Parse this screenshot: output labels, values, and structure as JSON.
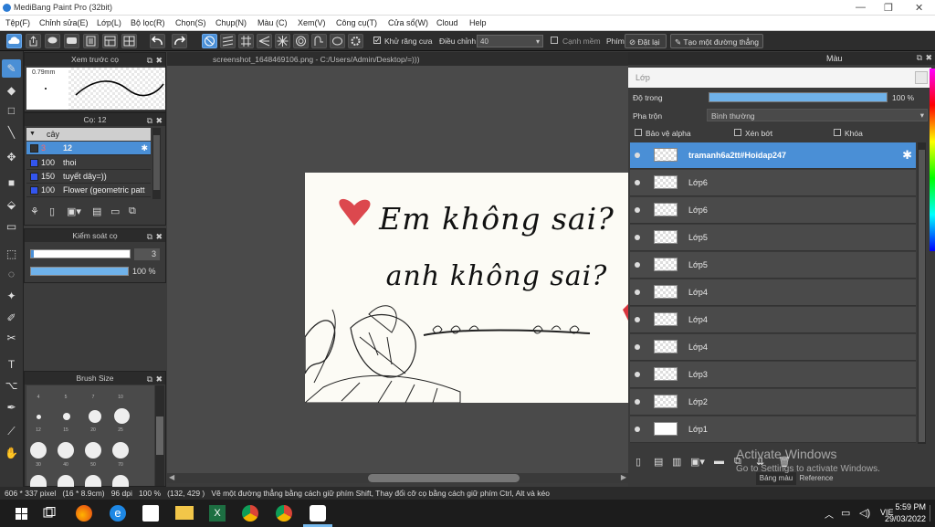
{
  "window": {
    "title": "MediBang Paint Pro (32bit)",
    "min": "—",
    "max": "❐",
    "close": "✕"
  },
  "menu": [
    "Tệp(F)",
    "Chỉnh sửa(E)",
    "Lớp(L)",
    "Bộ lọc(R)",
    "Chọn(S)",
    "Chụp(N)",
    "Màu (C)",
    "Xem(V)",
    "Công cụ(T)",
    "Cửa sổ(W)",
    "Cloud",
    "Help"
  ],
  "toolbar": {
    "antialias_label": "Khử răng cưa",
    "adjust_label": "Điều chỉnh",
    "adjust_value": "40",
    "edge_label": "Cạnh mềm",
    "key_label": "Phím",
    "reset_label": "Đặt lại",
    "line_label": "Tạo một đường thẳng"
  },
  "doc_tab": "screenshot_1648469106.png - C:/Users/Admin/Desktop/=)))",
  "preview": {
    "title": "Xem trước cọ",
    "size": "0.79mm"
  },
  "brush_panel": {
    "title": "Cọ: 12",
    "group": "cây",
    "items": [
      {
        "size": "3",
        "name": "12"
      },
      {
        "size": "100",
        "name": "thoi"
      },
      {
        "size": "150",
        "name": "tuyết dây=))"
      },
      {
        "size": "100",
        "name": "Flower (geometric patt"
      }
    ]
  },
  "control": {
    "title": "Kiểm soát cọ",
    "size_value": "3",
    "opacity_value": "100 %",
    "opacity_fraction": 1.0
  },
  "brush_size": {
    "title": "Brush Size",
    "labels": [
      "4",
      "5",
      "7",
      "10",
      "12",
      "15",
      "20",
      "25",
      "30",
      "40",
      "50",
      "70"
    ]
  },
  "canvas_text": {
    "line1": "Em không sai?",
    "line2": "anh không sai?"
  },
  "layer_panel": {
    "tab_color": "Màu",
    "header": "Lớp",
    "opacity_label": "Độ trong",
    "opacity_value": "100 %",
    "opacity_fraction": 1.0,
    "blend_label": "Pha trộn",
    "blend_value": "Bình thường",
    "protect_alpha": "Bảo vệ alpha",
    "clipping": "Xén bớt",
    "lock": "Khóa",
    "layers": [
      "tramanh6a2tt#Hoidap247",
      "Lớp6",
      "Lớp6",
      "Lớp5",
      "Lớp5",
      "Lớp4",
      "Lớp4",
      "Lớp4",
      "Lớp3",
      "Lớp2",
      "Lớp1"
    ],
    "bottom_tab1": "Bảng màu",
    "bottom_tab2": "Reference"
  },
  "status": "606 * 337 pixel   (16 * 8.9cm)   96 dpi   100 %   (132, 429 )   Vẽ một đường thẳng bằng cách giữ phím Shift, Thay đổi cỡ cọ bằng cách giữ phím Ctrl, Alt và kéo",
  "watermark": {
    "line1": "Activate Windows",
    "line2": "Go to Settings to activate Windows."
  },
  "taskbar": {
    "lang": "VIE",
    "time": "5:59 PM",
    "date": "29/03/2022"
  },
  "colors": {
    "accent": "#4a8fd6",
    "panel": "#3a3a3a",
    "toolbar": "#2d2d2d",
    "heart": "#d8343c",
    "brush_swatch": "#3355ee"
  }
}
